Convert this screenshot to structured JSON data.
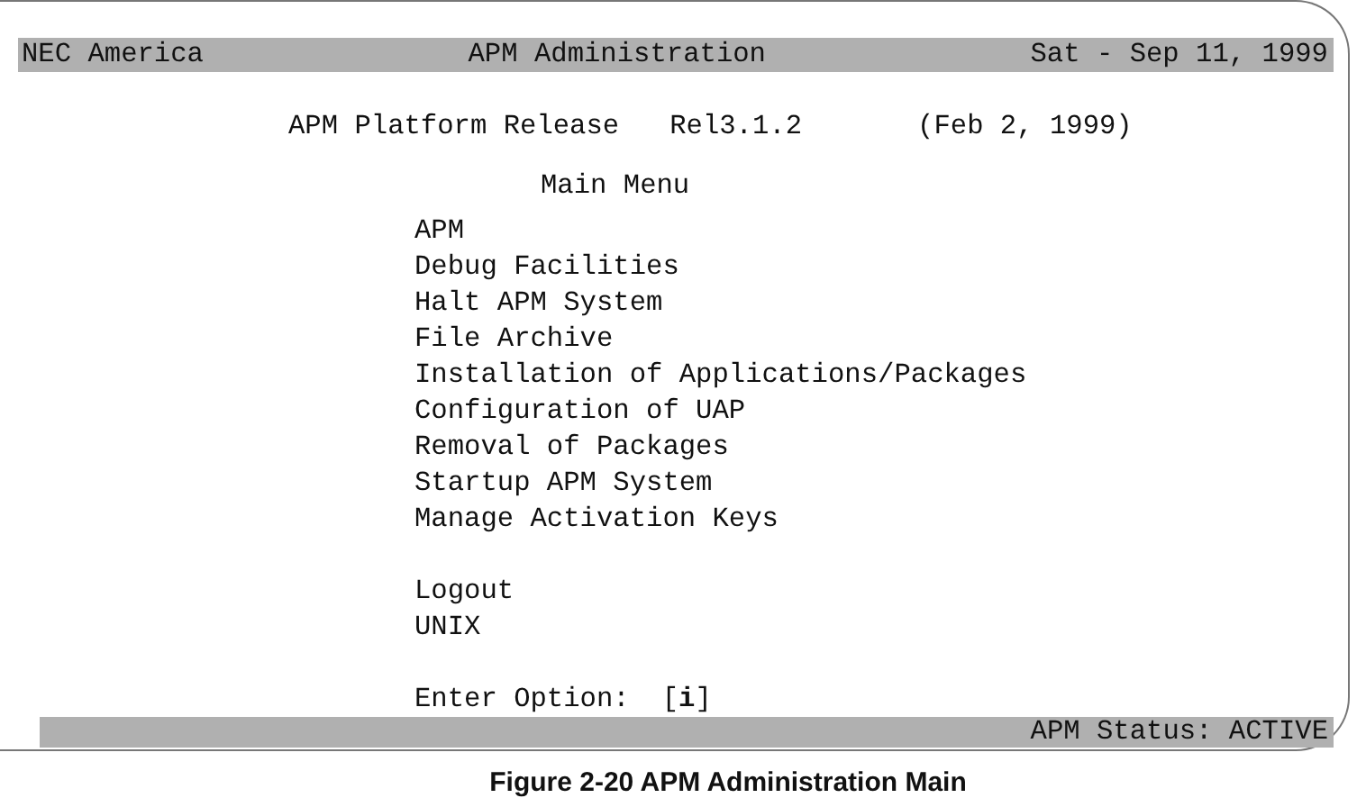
{
  "header": {
    "left": "NEC America",
    "center": "APM Administration",
    "right": "Sat - Sep 11, 1999"
  },
  "release": {
    "title": "APM Platform Release",
    "version": "Rel3.1.2",
    "date": "(Feb 2, 1999)"
  },
  "menu": {
    "title": "Main Menu",
    "items": [
      "APM",
      "Debug Facilities",
      "Halt APM System",
      "File Archive",
      "Installation of Applications/Packages",
      "Configuration of UAP",
      "Removal of Packages",
      "Startup APM System",
      "Manage Activation Keys"
    ],
    "extra_items": [
      "Logout",
      "UNIX"
    ]
  },
  "prompt": {
    "label": "Enter Option:",
    "value": "[**i**]"
  },
  "status": "APM Status: ACTIVE",
  "caption": "Figure 2-20   APM Administration Main"
}
